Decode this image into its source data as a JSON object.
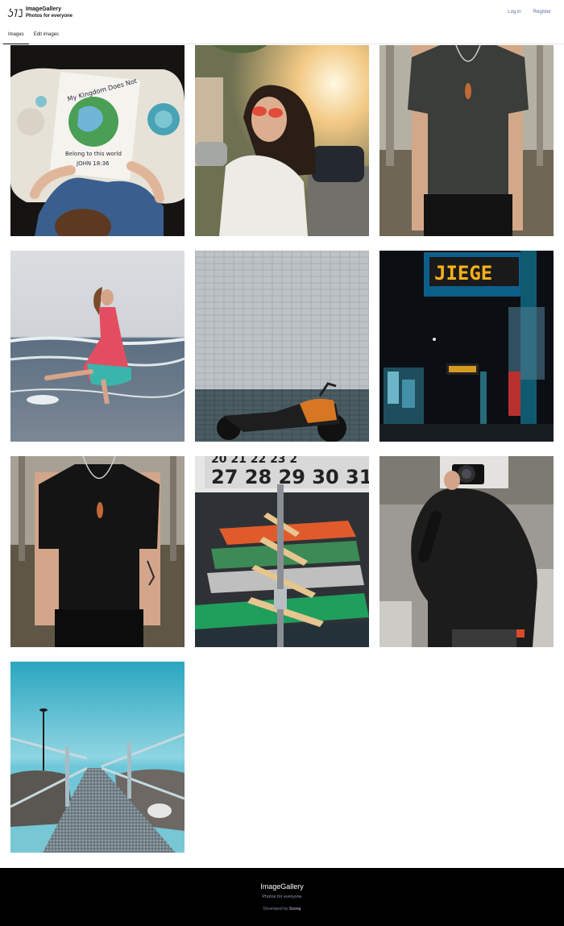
{
  "header": {
    "brand_name": "ImageGallery",
    "brand_tagline": "Photos for everyone",
    "login_label": "Log in",
    "register_label": "Register"
  },
  "tabs": [
    {
      "label": "Images",
      "active": true
    },
    {
      "label": "Edit images",
      "active": false
    }
  ],
  "gallery": [
    {
      "name": "child-drawing-photo"
    },
    {
      "name": "woman-sunglasses-photo"
    },
    {
      "name": "man-tshirt-necklace-photo"
    },
    {
      "name": "woman-dress-beach-photo"
    },
    {
      "name": "motorcycle-tiled-wall-photo"
    },
    {
      "name": "night-street-neon-photo"
    },
    {
      "name": "man-black-tshirt-photo"
    },
    {
      "name": "clothes-rack-hangers-photo"
    },
    {
      "name": "photographer-camera-photo"
    },
    {
      "name": "pier-walkway-sea-photo"
    }
  ],
  "photo_text": {
    "kingdom_line1": "My Kingdom Does Not",
    "kingdom_line2": "Belong to this world",
    "kingdom_ref": "JOHN 18:36",
    "calendar": "20 21 22 23 2",
    "calendar2": "27 28 29 30 31",
    "neon_sign": "JIEGE"
  },
  "footer": {
    "title": "ImageGallery",
    "tagline": "Photos for everyone",
    "developed_by": "Developed by",
    "developer": "Sooraj"
  },
  "colors": {
    "link": "#5b6fa8",
    "footer_bg": "#000000",
    "footer_tagline": "#8f9bb8"
  }
}
